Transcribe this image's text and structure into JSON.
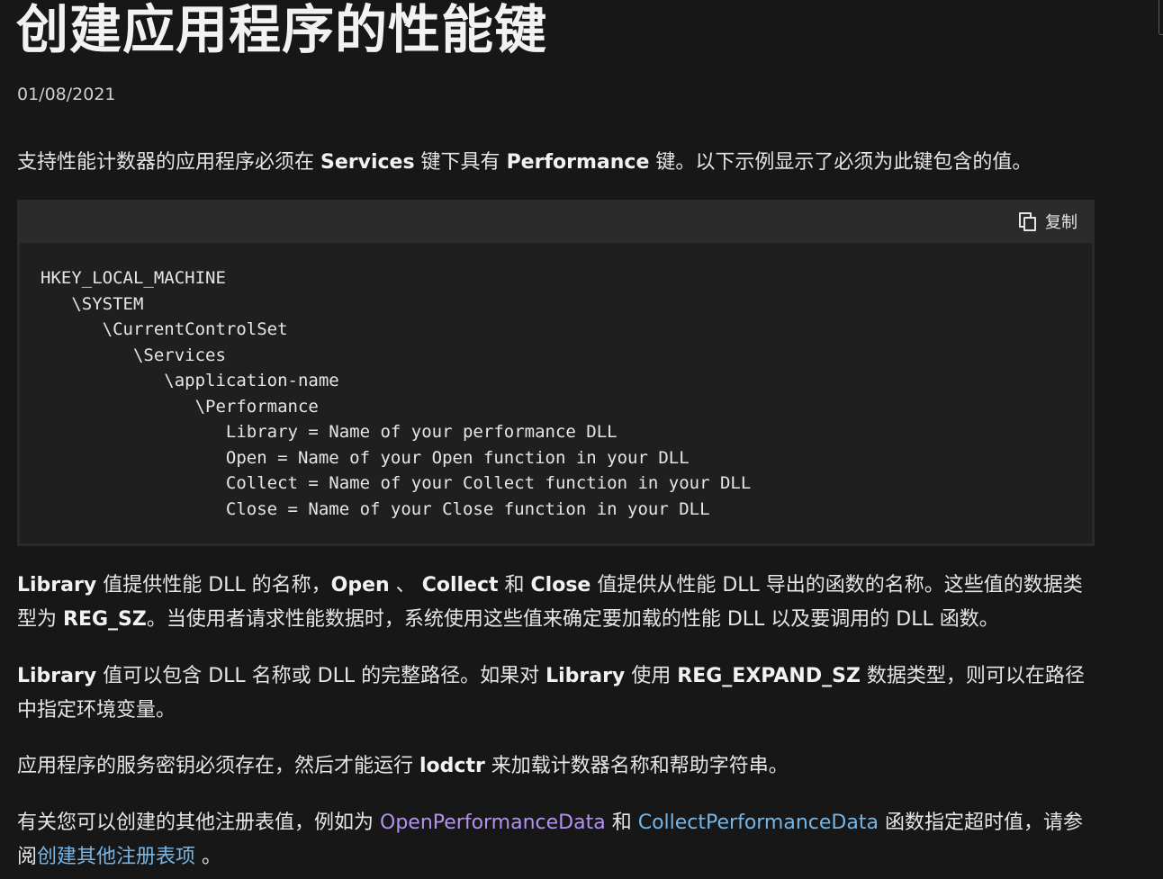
{
  "article": {
    "title": "创建应用程序的性能键",
    "date": "01/08/2021",
    "intro": {
      "t1": "支持性能计数器的应用程序必须在 ",
      "b1": "Services",
      "t2": " 键下具有 ",
      "b2": "Performance",
      "t3": " 键。以下示例显示了必须为此键包含的值。"
    },
    "code": {
      "copy_label": "复制",
      "lines": [
        "HKEY_LOCAL_MACHINE",
        "   \\SYSTEM",
        "      \\CurrentControlSet",
        "         \\Services",
        "            \\application-name",
        "               \\Performance",
        "                  Library = Name of your performance DLL",
        "                  Open = Name of your Open function in your DLL",
        "                  Collect = Name of your Collect function in your DLL",
        "                  Close = Name of your Close function in your DLL"
      ]
    },
    "p2": {
      "b1": "Library",
      "t1": " 值提供性能 DLL 的名称，",
      "b2": "Open",
      "t2": " 、 ",
      "b3": "Collect",
      "t3": " 和 ",
      "b4": "Close",
      "t4": " 值提供从性能 DLL 导出的函数的名称。这些值的数据类型为 ",
      "b5": "REG_SZ",
      "t5": "。当使用者请求性能数据时，系统使用这些值来确定要加载的性能 DLL 以及要调用的 DLL 函数。"
    },
    "p3": {
      "b1": "Library",
      "t1": " 值可以包含 DLL 名称或 DLL 的完整路径。如果对 ",
      "b2": "Library",
      "t2": " 使用 ",
      "b3": "REG_EXPAND_SZ",
      "t3": " 数据类型，则可以在路径中指定环境变量。"
    },
    "p4": {
      "t1": "应用程序的服务密钥必须存在，然后才能运行 ",
      "b1": "lodctr",
      "t2": " 来加载计数器名称和帮助字符串。"
    },
    "p5": {
      "t1": "有关您可以创建的其他注册表值，例如为 ",
      "link1": "OpenPerformanceData",
      "t2": " 和 ",
      "link2": "CollectPerformanceData",
      "t3": " 函数指定超时值，请参阅",
      "link3": "创建其他注册表项",
      "t4": " 。"
    }
  },
  "colors": {
    "background": "#171717",
    "code_background": "#1f1f1f",
    "code_frame": "#2b2b2b",
    "link": "#75b6e7",
    "link_visited": "#b392f0"
  }
}
